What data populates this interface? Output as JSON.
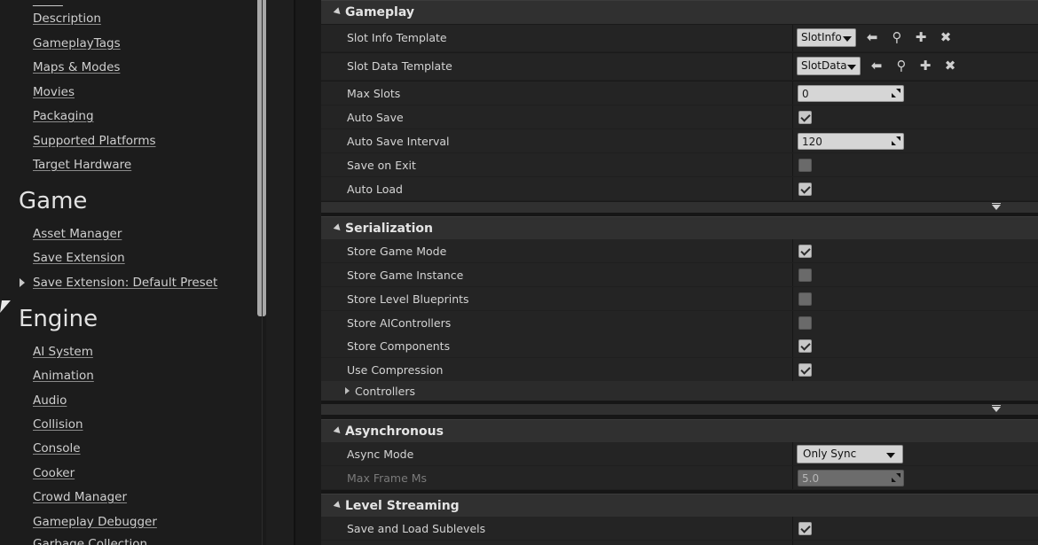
{
  "sidebar": {
    "project_links": [
      "Description",
      "GameplayTags",
      "Maps & Modes",
      "Movies",
      "Packaging",
      "Supported Platforms",
      "Target Hardware"
    ],
    "game_heading": "Game",
    "game_links": [
      "Asset Manager",
      "Save Extension",
      "Save Extension: Default Preset"
    ],
    "engine_heading": "Engine",
    "engine_links": [
      "AI System",
      "Animation",
      "Audio",
      "Collision",
      "Console",
      "Cooker",
      "Crowd Manager",
      "Gameplay Debugger",
      "Garbage Collection"
    ]
  },
  "gameplay": {
    "title": "Gameplay",
    "slot_info_label": "Slot Info Template",
    "slot_info_value": "SlotInfo",
    "slot_data_label": "Slot Data Template",
    "slot_data_value": "SlotData",
    "max_slots_label": "Max Slots",
    "max_slots_value": "0",
    "auto_save_label": "Auto Save",
    "auto_save_checked": true,
    "auto_save_interval_label": "Auto Save Interval",
    "auto_save_interval_value": "120",
    "save_on_exit_label": "Save on Exit",
    "save_on_exit_checked": false,
    "auto_load_label": "Auto Load",
    "auto_load_checked": true
  },
  "serialization": {
    "title": "Serialization",
    "rows": [
      {
        "label": "Store Game Mode",
        "checked": true
      },
      {
        "label": "Store Game Instance",
        "checked": false
      },
      {
        "label": "Store Level Blueprints",
        "checked": false
      },
      {
        "label": "Store AIControllers",
        "checked": false
      },
      {
        "label": "Store Components",
        "checked": true
      },
      {
        "label": "Use Compression",
        "checked": true
      }
    ],
    "controllers_label": "Controllers"
  },
  "asynchronous": {
    "title": "Asynchronous",
    "async_mode_label": "Async Mode",
    "async_mode_value": "Only Sync",
    "max_frame_label": "Max Frame Ms",
    "max_frame_value": "5.0"
  },
  "level_streaming": {
    "title": "Level Streaming",
    "save_load_sublevels_label": "Save and Load Sublevels",
    "save_load_sublevels_checked": true
  },
  "icons": {
    "use_selected": "arrow-left-icon",
    "browse": "search-icon",
    "add": "plus-icon",
    "clear": "x-icon"
  }
}
